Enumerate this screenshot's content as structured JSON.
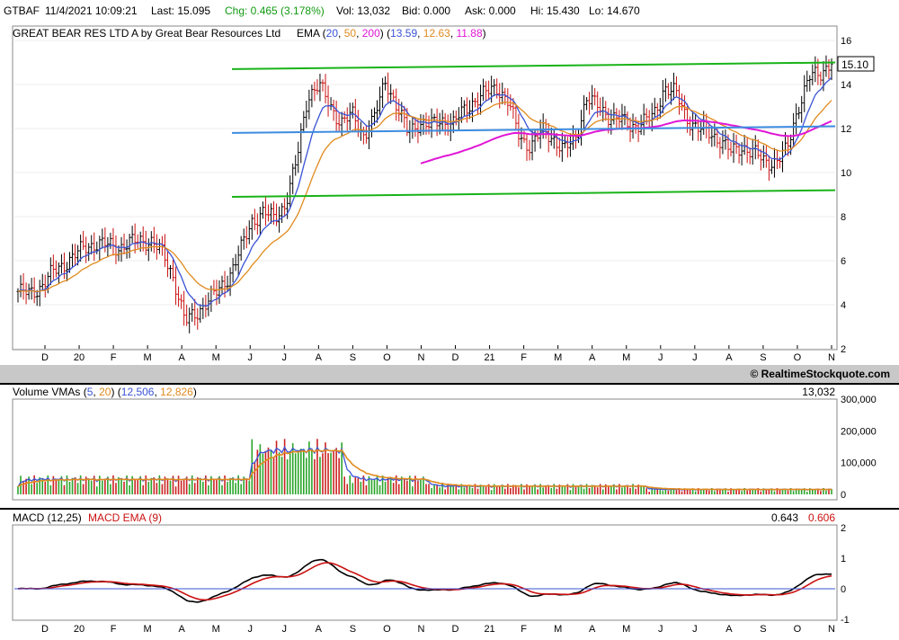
{
  "quote": {
    "symbol": "GTBAF",
    "datetime": "11/4/2021 10:09:21",
    "last": "Last: 15.095",
    "chg": "Chg: 0.465 (3.178%)",
    "vol": "Vol: 13,032",
    "bid": "Bid: 0.000",
    "ask": "Ask: 0.000",
    "hi": "Hi: 15.430",
    "lo": "Lo: 14.670"
  },
  "price_panel": {
    "title": "GREAT BEAR RES LTD A by Great Bear Resources Ltd",
    "ema_label": "EMA (",
    "ema_periods": [
      "20",
      "50",
      "200"
    ],
    "ema_values": [
      "13.59",
      "12.63",
      "11.88"
    ],
    "last_tag": "15.10",
    "copyright": "© RealtimeStockquote.com"
  },
  "volume_panel": {
    "title": "Volume",
    "vma_label": "VMAs (",
    "vma_periods": [
      "5",
      "20"
    ],
    "vma_values": [
      "12,506",
      "12,826"
    ],
    "last_volume": "13,032"
  },
  "macd_panel": {
    "title": "MACD (12,25)",
    "ema_label": "MACD EMA (9)",
    "macd_value": "0.643",
    "signal_value": "0.606"
  },
  "colors": {
    "ema20": "#3a53d6",
    "ema50": "#e08a1e",
    "ema200": "#e016d6",
    "trend_green": "#19b319",
    "trend_blue": "#3c8ce0",
    "vol_up": "#2aa52a",
    "vol_down": "#cc2222",
    "macd": "#000000",
    "macd_signal": "#cc1111"
  },
  "chart_data": [
    {
      "type": "candlestick",
      "title": "GREAT BEAR RES LTD A by Great Bear Resources Ltd",
      "x_tick_labels": [
        "D",
        "20",
        "F",
        "M",
        "A",
        "M",
        "J",
        "J",
        "A",
        "S",
        "O",
        "N",
        "D",
        "21",
        "F",
        "M",
        "A",
        "M",
        "J",
        "J",
        "A",
        "S",
        "O",
        "N"
      ],
      "y_ticks": [
        2,
        4,
        6,
        8,
        10,
        12,
        14,
        16
      ],
      "ylim": [
        2,
        16
      ],
      "series": [
        {
          "name": "EMA 20",
          "last": 13.59
        },
        {
          "name": "EMA 50",
          "last": 12.63
        },
        {
          "name": "EMA 200",
          "last": 11.88
        }
      ],
      "close_approx": [
        4.6,
        4.5,
        4.8,
        5.4,
        5.8,
        6.2,
        6.6,
        6.8,
        6.7,
        6.6,
        6.8,
        6.9,
        6.9,
        6.3,
        5.2,
        3.2,
        3.6,
        4.2,
        4.6,
        5.4,
        6.5,
        7.8,
        8.2,
        7.9,
        8.6,
        10.5,
        13.5,
        14.0,
        13.0,
        12.3,
        12.6,
        11.7,
        12.5,
        14.2,
        13.0,
        11.8,
        12.3,
        12.1,
        12.4,
        12.2,
        12.8,
        13.3,
        13.6,
        13.9,
        13.2,
        11.6,
        11.2,
        11.9,
        11.6,
        11.0,
        11.5,
        13.4,
        13.0,
        12.6,
        12.4,
        12.1,
        12.3,
        12.5,
        13.9,
        13.6,
        12.5,
        12.0,
        11.8,
        11.5,
        10.9,
        11.2,
        10.9,
        10.5,
        10.5,
        11.0,
        13.0,
        14.3,
        14.5,
        15.1
      ],
      "trendlines": [
        {
          "color": "green",
          "from": 14.7,
          "to": 15.0
        },
        {
          "color": "green",
          "from": 8.9,
          "to": 9.2
        },
        {
          "color": "blue",
          "from": 11.8,
          "to": 12.1
        }
      ],
      "last_price": 15.1
    },
    {
      "type": "bar",
      "title": "Volume",
      "y_tick_labels": [
        "0",
        "100,000",
        "200,000",
        "300,000"
      ],
      "ylim": [
        0,
        300000
      ],
      "series": [
        {
          "name": "VMA 5",
          "last": 12506
        },
        {
          "name": "VMA 20",
          "last": 12826
        }
      ],
      "last_volume": 13032
    },
    {
      "type": "line",
      "title": "MACD (12,25)",
      "y_ticks": [
        -1,
        0,
        1,
        2
      ],
      "ylim": [
        -1,
        2
      ],
      "series": [
        {
          "name": "MACD (12,25)",
          "last": 0.643
        },
        {
          "name": "MACD EMA (9)",
          "last": 0.606
        }
      ]
    }
  ]
}
